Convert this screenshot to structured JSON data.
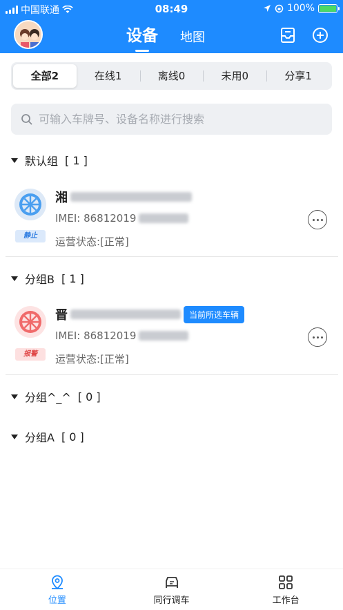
{
  "status_bar": {
    "carrier": "中国联通",
    "time": "08:49",
    "battery": "100%"
  },
  "header": {
    "tabs": [
      {
        "label": "设备"
      },
      {
        "label": "地图"
      }
    ]
  },
  "segments": [
    {
      "label": "全部2"
    },
    {
      "label": "在线1"
    },
    {
      "label": "离线0"
    },
    {
      "label": "未用0"
    },
    {
      "label": "分享1"
    }
  ],
  "search": {
    "placeholder": "可输入车牌号、设备名称进行搜索"
  },
  "groups": [
    {
      "name": "默认组",
      "count": "[ 1 ]"
    },
    {
      "name": "分组B",
      "count": "[ 1 ]"
    },
    {
      "name": "分组^_^",
      "count": "[ 0 ]"
    },
    {
      "name": "分组A",
      "count": "[ 0 ]"
    }
  ],
  "devices": [
    {
      "plate_prefix": "湘",
      "imei": "IMEI: 86812019",
      "status": "运营状态:[正常]",
      "badge": "静止",
      "color": "#4a9ff0"
    },
    {
      "plate_prefix": "晋",
      "imei": "IMEI: 86812019",
      "status": "运营状态:[正常]",
      "badge": "报警",
      "color": "#f06a6a",
      "tag": "当前所选车辆"
    }
  ],
  "bottom_nav": [
    {
      "label": "位置"
    },
    {
      "label": "同行调车"
    },
    {
      "label": "工作台"
    }
  ],
  "colors": {
    "accent": "#1e8bff",
    "alarm": "#f06a6a",
    "still": "#4a9ff0"
  }
}
